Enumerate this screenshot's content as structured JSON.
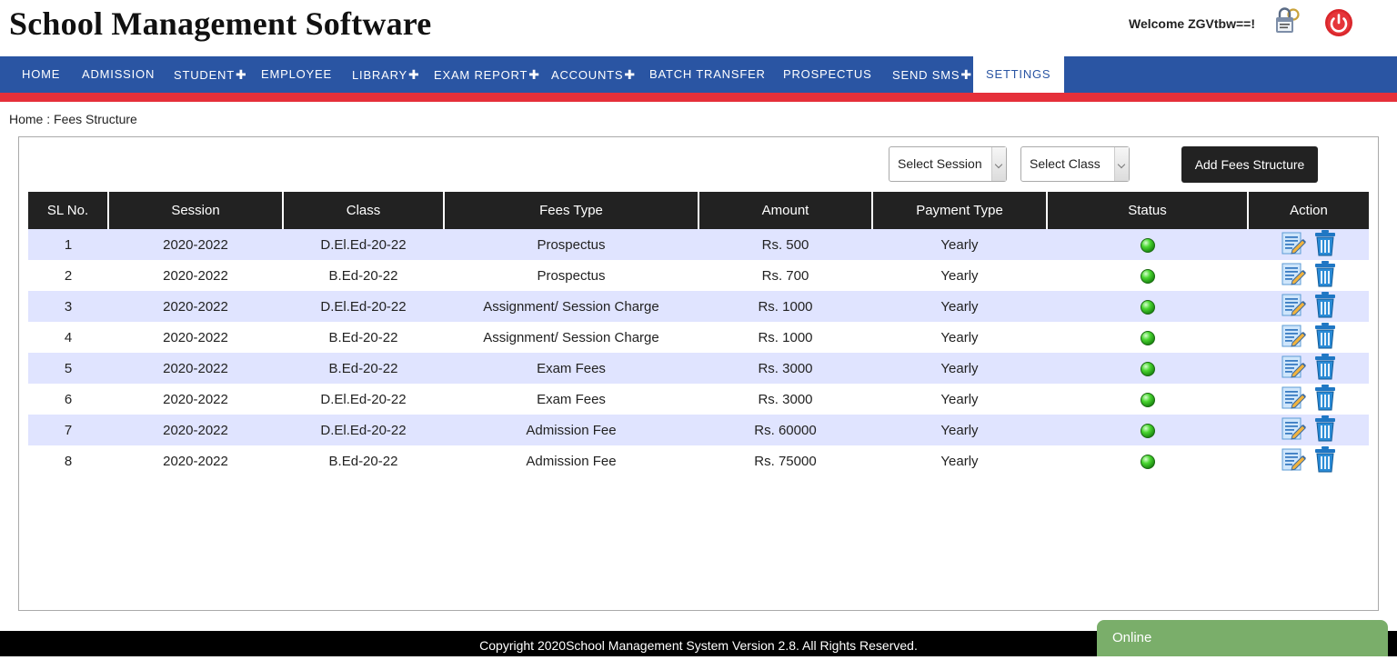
{
  "header": {
    "title": "School Management Software",
    "welcome": "Welcome ZGVtbw==!",
    "icons": [
      "password-lock-icon",
      "power-icon"
    ],
    "colors": {
      "nav": "#2a55a3",
      "stripe": "#e5303a",
      "power": "#d9262b"
    }
  },
  "nav": [
    {
      "label": "HOME",
      "plus": ""
    },
    {
      "label": "ADMISSION",
      "plus": ""
    },
    {
      "label": "STUDENT",
      "plus": "✚"
    },
    {
      "label": "EMPLOYEE",
      "plus": ""
    },
    {
      "label": "LIBRARY",
      "plus": "✚"
    },
    {
      "label": "EXAM REPORT",
      "plus": "✚"
    },
    {
      "label": "ACCOUNTS",
      "plus": "✚"
    },
    {
      "label": "BATCH TRANSFER",
      "plus": ""
    },
    {
      "label": "PROSPECTUS",
      "plus": ""
    },
    {
      "label": "SEND SMS",
      "plus": "✚"
    },
    {
      "label": "SETTINGS",
      "plus": "",
      "active": true
    }
  ],
  "breadcrumb": "Home : Fees Structure",
  "filters": {
    "session": "Select Session",
    "class": "Select Class",
    "add_button": "Add Fees Structure"
  },
  "table": {
    "headers": [
      "SL No.",
      "Session",
      "Class",
      "Fees Type",
      "Amount",
      "Payment Type",
      "Status",
      "Action"
    ],
    "rows": [
      [
        "1",
        "2020-2022",
        "D.El.Ed-20-22",
        "Prospectus",
        "Rs. 500",
        "Yearly"
      ],
      [
        "2",
        "2020-2022",
        "B.Ed-20-22",
        "Prospectus",
        "Rs. 700",
        "Yearly"
      ],
      [
        "3",
        "2020-2022",
        "D.El.Ed-20-22",
        "Assignment/ Session Charge",
        "Rs. 1000",
        "Yearly"
      ],
      [
        "4",
        "2020-2022",
        "B.Ed-20-22",
        "Assignment/ Session Charge",
        "Rs. 1000",
        "Yearly"
      ],
      [
        "5",
        "2020-2022",
        "B.Ed-20-22",
        "Exam Fees",
        "Rs. 3000",
        "Yearly"
      ],
      [
        "6",
        "2020-2022",
        "D.El.Ed-20-22",
        "Exam Fees",
        "Rs. 3000",
        "Yearly"
      ],
      [
        "7",
        "2020-2022",
        "D.El.Ed-20-22",
        "Admission Fee",
        "Rs. 60000",
        "Yearly"
      ],
      [
        "8",
        "2020-2022",
        "B.Ed-20-22",
        "Admission Fee",
        "Rs. 75000",
        "Yearly"
      ]
    ],
    "status_icon": "green-status-led-icon",
    "action_icons": [
      "edit-icon",
      "delete-trash-icon"
    ]
  },
  "footer": "Copyright 2020School Management System Version 2.8. All Rights Reserved.",
  "chat": "Online"
}
